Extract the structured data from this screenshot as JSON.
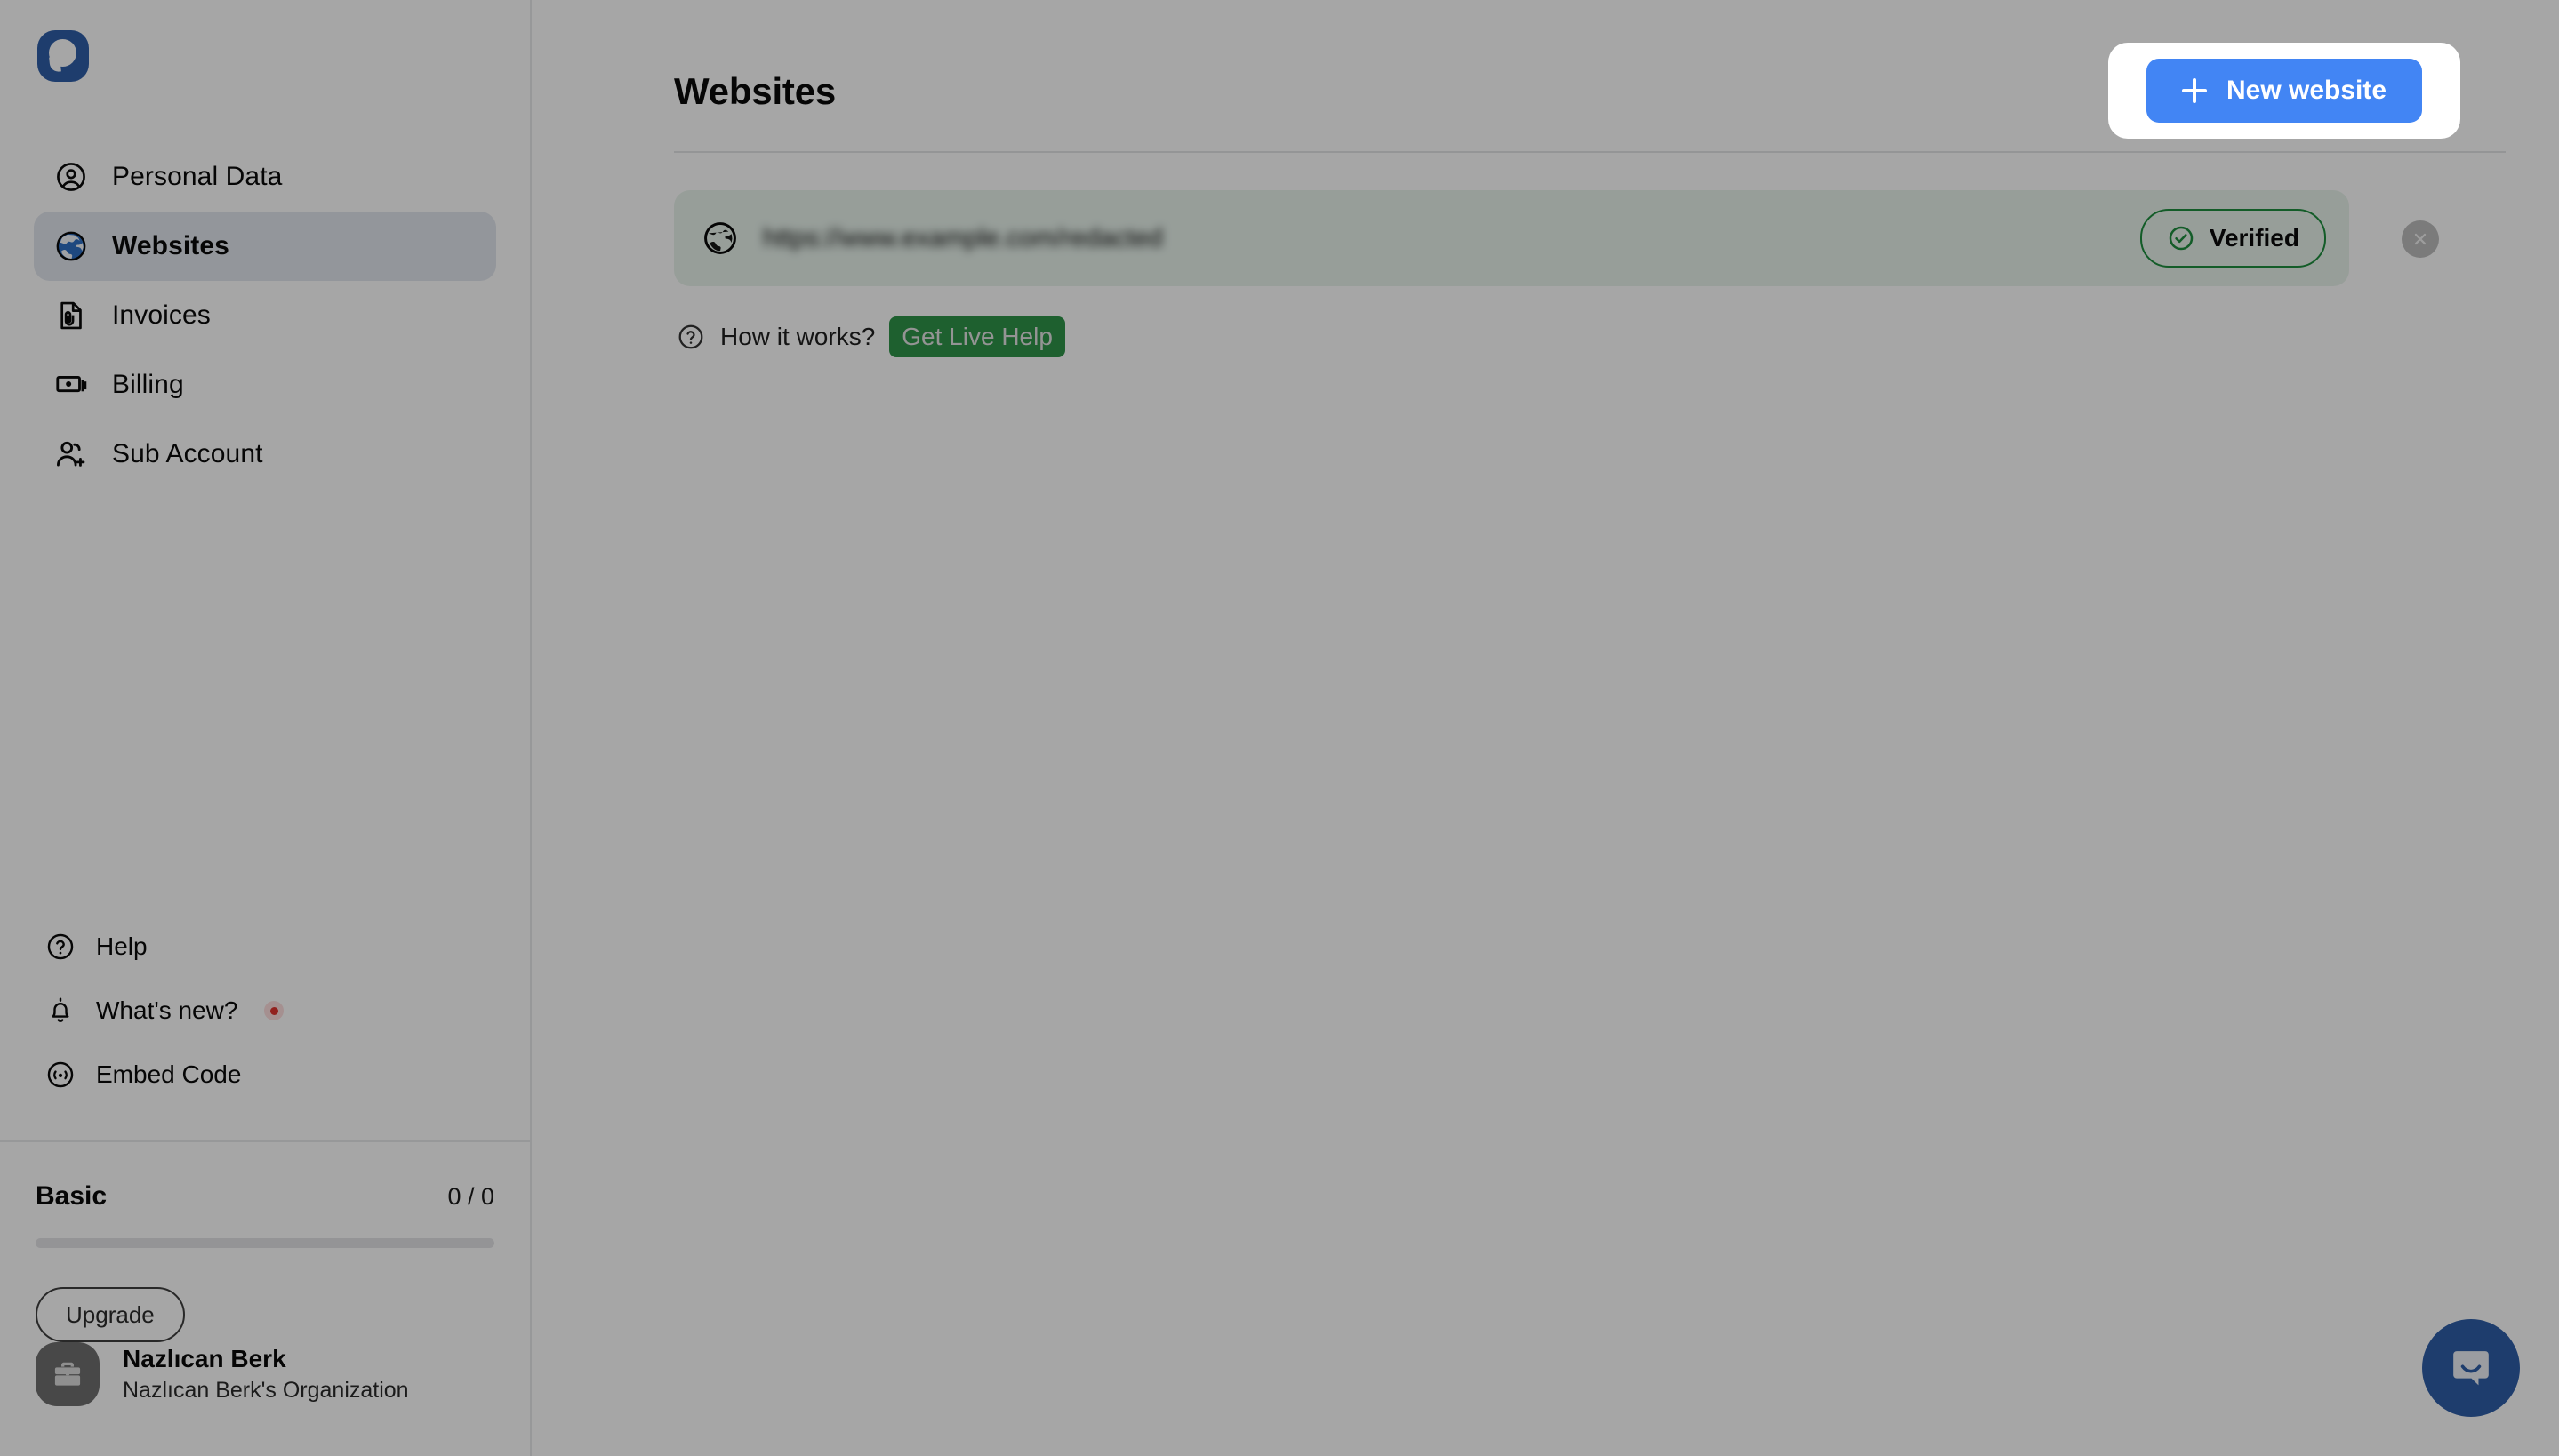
{
  "brand": {
    "logo_icon": "paykassma-bubble-logo",
    "accent_blue": "#4285f4",
    "logo_blue": "#2f5fa8",
    "verified_green": "#1e8e3e",
    "live_help_green": "#2e9449"
  },
  "sidebar": {
    "primary_items": [
      {
        "id": "personal-data",
        "label": "Personal Data",
        "icon": "user-circle-icon",
        "active": false
      },
      {
        "id": "websites",
        "label": "Websites",
        "icon": "globe-icon",
        "active": true
      },
      {
        "id": "invoices",
        "label": "Invoices",
        "icon": "invoice-document-icon",
        "active": false
      },
      {
        "id": "billing",
        "label": "Billing",
        "icon": "banknote-icon",
        "active": false
      },
      {
        "id": "sub-account",
        "label": "Sub Account",
        "icon": "user-plus-icon",
        "active": false
      }
    ],
    "secondary_items": [
      {
        "id": "help",
        "label": "Help",
        "icon": "question-circle-icon",
        "badge": false
      },
      {
        "id": "whats-new",
        "label": "What's new?",
        "icon": "bell-icon",
        "badge": true
      },
      {
        "id": "embed-code",
        "label": "Embed Code",
        "icon": "broadcast-icon",
        "badge": false
      }
    ],
    "plan": {
      "name": "Basic",
      "usage": "0 / 0",
      "progress_percent": 0,
      "upgrade_label": "Upgrade"
    },
    "account": {
      "avatar_icon": "briefcase-icon",
      "name": "Nazlıcan Berk",
      "organization": "Nazlıcan Berk's Organization"
    }
  },
  "main": {
    "title": "Websites",
    "new_website_button": {
      "label": "New website",
      "icon": "plus-icon"
    },
    "websites": [
      {
        "icon": "globe-icon",
        "url": "https://www.example.com/redacted",
        "status_label": "Verified",
        "status_icon": "check-circle-icon",
        "remove_icon": "close-icon"
      }
    ],
    "how_it_works": {
      "icon": "question-circle-icon",
      "label": "How it works?",
      "cta_label": "Get Live Help"
    }
  },
  "chat_widget": {
    "icon": "intercom-chat-bubble-icon",
    "label": "Open chat"
  }
}
